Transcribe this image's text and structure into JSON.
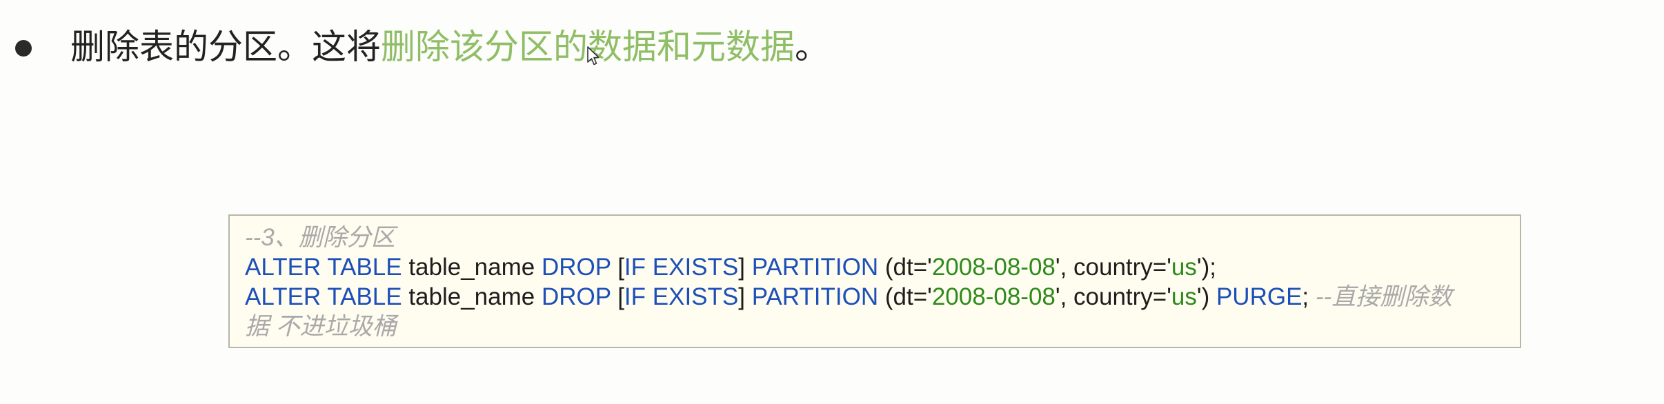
{
  "bullet": {
    "normal_text": "删除表的分区。这将",
    "highlight_text": "删除该分区的数据和元数据",
    "end_text": "。"
  },
  "code": {
    "comment_title": "--3、删除分区",
    "line1": {
      "kw_alter": "ALTER TABLE",
      "table": " table_name ",
      "kw_drop": "DROP",
      "bracket_open": " [",
      "kw_if_exists": "IF EXISTS",
      "bracket_close": "] ",
      "kw_partition": "PARTITION",
      "paren_dt": " (dt='",
      "dt_value": "2008-08-08",
      "comma_country": "', country='",
      "country_value": "us",
      "end": "');"
    },
    "line2": {
      "kw_alter": "ALTER TABLE",
      "table": " table_name ",
      "kw_drop": "DROP",
      "bracket_open": " [",
      "kw_if_exists": "IF EXISTS",
      "bracket_close": "] ",
      "kw_partition": "PARTITION",
      "paren_dt": " (dt='",
      "dt_value": "2008-08-08",
      "comma_country": "', country='",
      "country_value": "us",
      "close_paren": "') ",
      "kw_purge": "PURGE",
      "semicolon": "; ",
      "comment_a": "--直接删除数"
    },
    "comment_wrap": "据 不进垃圾桶"
  },
  "colors": {
    "highlight": "#8fbe66",
    "keyword": "#1d4fb8",
    "string": "#2e8a1c",
    "comment": "#a9a9a9",
    "code_background": "#fffdf0"
  },
  "icons": {
    "cursor": "mouse-pointer-icon",
    "bullet": "bullet-dot-icon"
  }
}
